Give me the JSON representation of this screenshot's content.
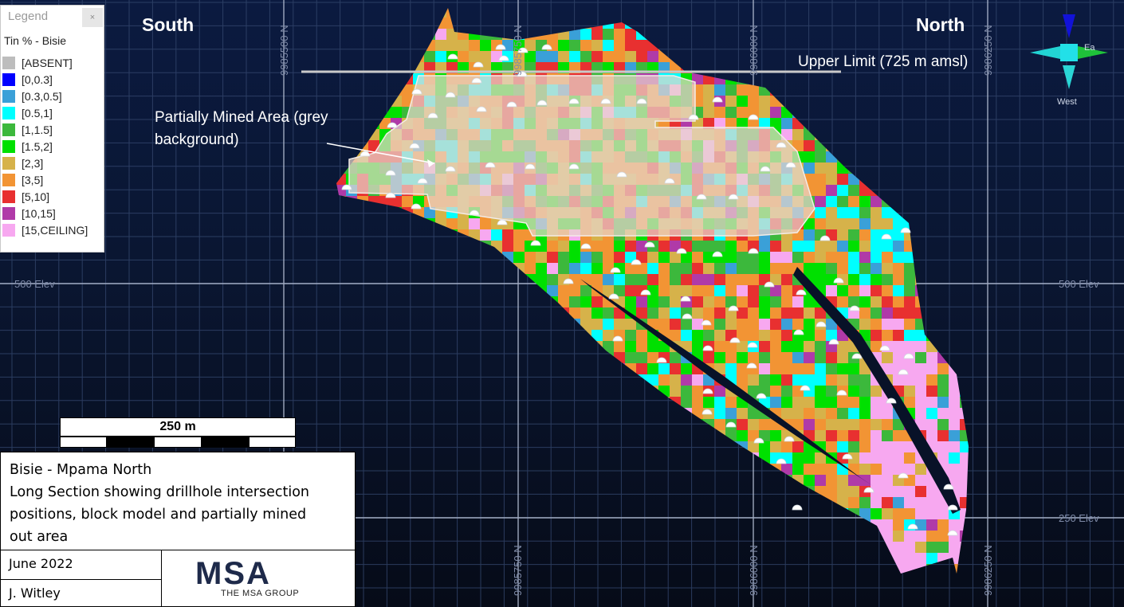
{
  "directions": {
    "south": "South",
    "north": "North"
  },
  "annotations": {
    "upper_limit": "Upper Limit (725 m amsl)",
    "mined_area": "Partially Mined Area (grey background)"
  },
  "grid_labels": {
    "northings": [
      "9985500 N",
      "9985750 N",
      "9986000 N",
      "9986250 N"
    ],
    "elevations": [
      "500 Elev",
      "250 Elev"
    ]
  },
  "compass": {
    "west": "West",
    "east_partial": "Ea"
  },
  "legend": {
    "title": "Legend",
    "close": "×",
    "heading": "Tin % - Bisie",
    "items": [
      {
        "label": "[ABSENT]",
        "color": "#bdbdbd"
      },
      {
        "label": "[0,0.3]",
        "color": "#0000ff"
      },
      {
        "label": "[0.3,0.5]",
        "color": "#3aa0d8"
      },
      {
        "label": "[0.5,1]",
        "color": "#00ffff"
      },
      {
        "label": "[1,1.5]",
        "color": "#3cb83c"
      },
      {
        "label": "[1.5,2]",
        "color": "#00e000"
      },
      {
        "label": "[2,3]",
        "color": "#d6b24a"
      },
      {
        "label": "[3,5]",
        "color": "#f29434"
      },
      {
        "label": "[5,10]",
        "color": "#e83030"
      },
      {
        "label": "[10,15]",
        "color": "#b03aa8"
      },
      {
        "label": "[15,CEILING]",
        "color": "#f7a8f0"
      }
    ]
  },
  "scale_bar": {
    "label": "250 m"
  },
  "title_block": {
    "title": "Bisie - Mpama North\nLong Section showing drillhole intersection positions, block model and partially mined out  area",
    "title_line1": "Bisie - Mpama North",
    "title_line2": "Long Section showing drillhole intersection",
    "title_line3": "positions, block model and partially mined",
    "title_line4": "out  area",
    "date": "June 2022",
    "author": "J. Witley",
    "logo_text": "MSA",
    "logo_subtext": "THE MSA GROUP"
  }
}
